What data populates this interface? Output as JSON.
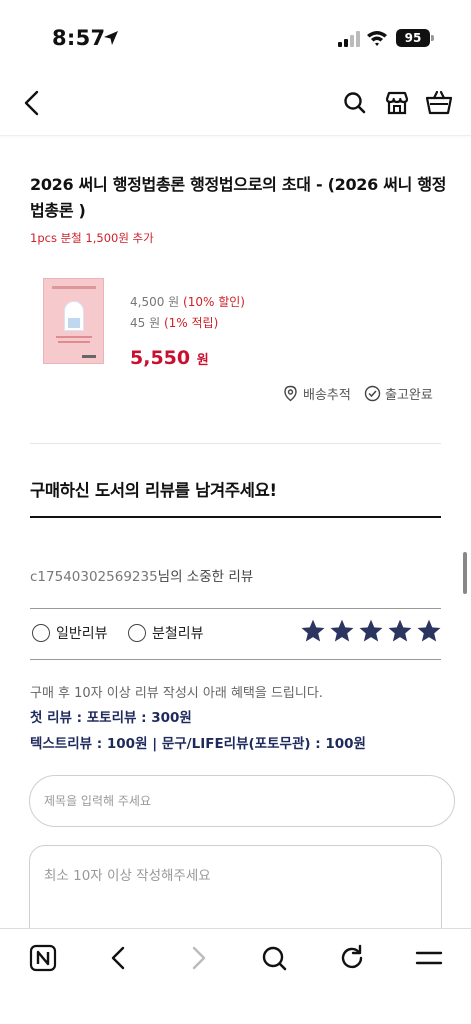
{
  "status_bar": {
    "time": "8:57",
    "battery": "95"
  },
  "header": {
    "icons": [
      "chevron-left-icon",
      "search-icon",
      "store-icon",
      "basket-icon"
    ]
  },
  "product": {
    "title": "2026 써니 행정법총론 행정법으로의 초대 - (2026 써니 행정법총론 )",
    "note": "1pcs 분철 1,500원 추가",
    "original_price": "4,500 원",
    "discount": "(10% 할인)",
    "points": "45 원",
    "points_rate": "(1% 적립)",
    "final_price": "5,550",
    "final_unit": "원",
    "track_label": "배송추적",
    "done_label": "출고완료"
  },
  "review": {
    "heading": "구매하신 도서의 리뷰를 남겨주세요!",
    "reviewer_id": "c17540302569235",
    "reviewer_suffix": "님의 소중한 리뷰",
    "type_general": "일반리뷰",
    "type_split": "분철리뷰",
    "rating": 5,
    "benefit_intro": "구매 후 10자 이상 리뷰 작성시 아래 혜택을 드립니다.",
    "benefit_1": "첫 리뷰 : 포토리뷰 : 300원",
    "benefit_2": "텍스트리뷰 : 100원  |  문구/LIFE리뷰(포토무관) : 100원",
    "title_placeholder": "제목을 입력해 주세요",
    "body_placeholder": "최소 10자 이상 작성해주세요"
  },
  "colors": {
    "accent_red": "#c8102e",
    "star_navy": "#2b3560",
    "benefit_navy": "#1f2a5c"
  }
}
